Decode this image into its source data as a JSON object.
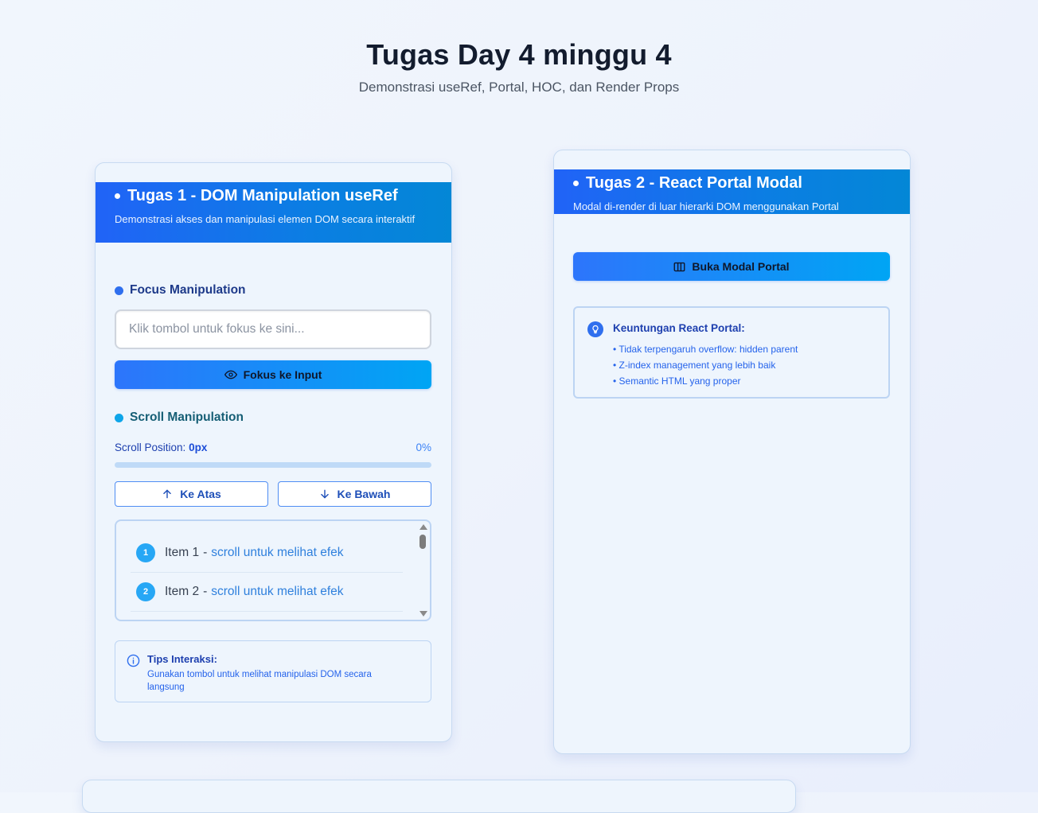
{
  "page": {
    "title": "Tugas Day 4 minggu 4",
    "subtitle": "Demonstrasi useRef, Portal, HOC, dan Render Props"
  },
  "task1": {
    "title": "Tugas 1 - DOM Manipulation useRef",
    "description": "Demonstrasi akses dan manipulasi elemen DOM secara interaktif",
    "focus": {
      "label": "Focus Manipulation",
      "input_value": "",
      "input_placeholder": "Klik tombol untuk fokus ke sini...",
      "button_label": "Fokus ke Input"
    },
    "scroll": {
      "label": "Scroll Manipulation",
      "position_label": "Scroll Position:",
      "position_value": "0px",
      "percent_text": "0%",
      "progress": 0,
      "up_label": "Ke Atas",
      "down_label": "Ke Bawah",
      "items": [
        {
          "num": "1",
          "name": "Item 1",
          "hint": "scroll untuk melihat efek"
        },
        {
          "num": "2",
          "name": "Item 2",
          "hint": "scroll untuk melihat efek"
        }
      ],
      "separator": "-"
    },
    "tips": {
      "title": "Tips Interaksi:",
      "text": "Gunakan tombol untuk melihat manipulasi DOM secara langsung"
    }
  },
  "task2": {
    "title": "Tugas 2 - React Portal Modal",
    "description": "Modal di-render di luar hierarki DOM menggunakan Portal",
    "button_label": "Buka Modal Portal",
    "benefits": {
      "title": "Keuntungan React Portal:",
      "items": [
        "• Tidak terpengaruh overflow: hidden parent",
        "• Z-index management yang lebih baik",
        "• Semantic HTML yang proper"
      ]
    }
  },
  "colors": {
    "header_gradient_start": "#2163f7",
    "header_gradient_end": "#0387d6",
    "primary_button_start": "#2d75fb",
    "primary_button_end": "#00a5f4",
    "accent_blue": "#2f6fee"
  },
  "icons": {
    "focus_button": "eye-icon",
    "up_button": "arrow-up-icon",
    "down_button": "arrow-down-icon",
    "tips": "info-icon",
    "portal_button": "columns-icon",
    "benefits": "lightbulb-icon"
  }
}
